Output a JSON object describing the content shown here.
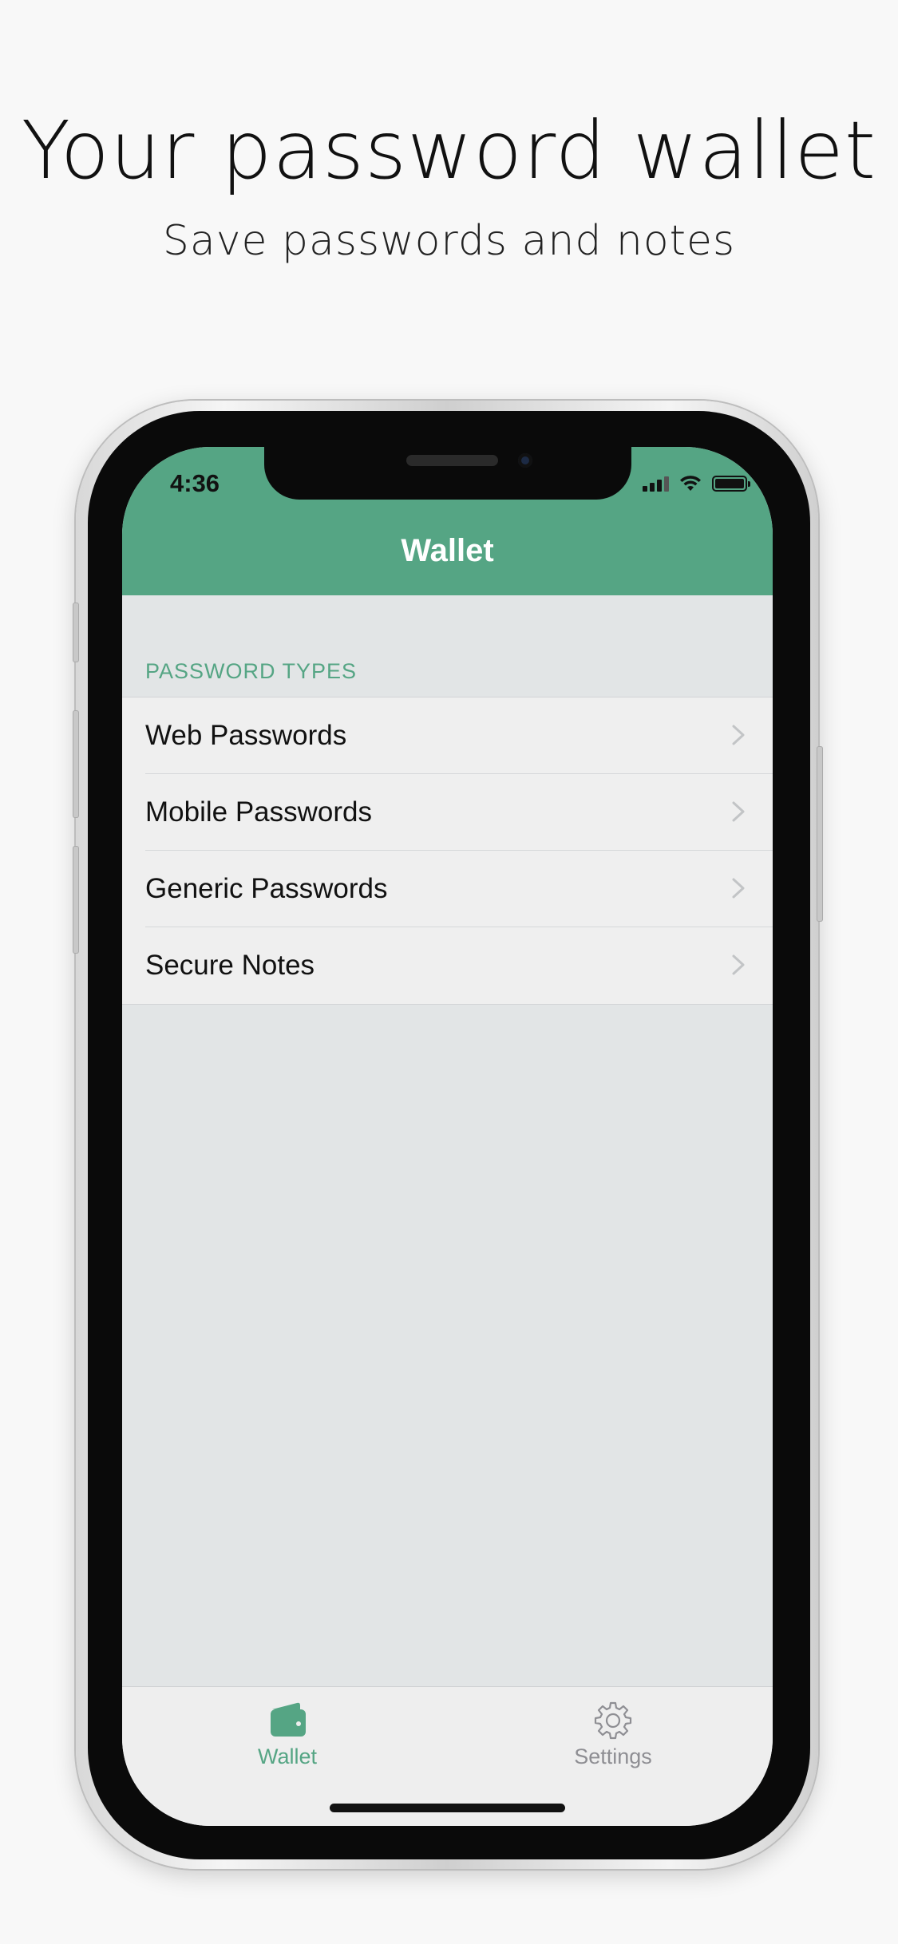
{
  "promo": {
    "headline": "Your password wallet",
    "subheadline": "Save passwords and notes"
  },
  "status_bar": {
    "time": "4:36"
  },
  "navbar": {
    "title": "Wallet"
  },
  "section": {
    "header": "PASSWORD TYPES"
  },
  "list": {
    "items": [
      {
        "label": "Web Passwords"
      },
      {
        "label": "Mobile Passwords"
      },
      {
        "label": "Generic Passwords"
      },
      {
        "label": "Secure Notes"
      }
    ]
  },
  "tabbar": {
    "tabs": [
      {
        "label": "Wallet",
        "icon": "wallet-icon",
        "selected": true
      },
      {
        "label": "Settings",
        "icon": "gear-icon",
        "selected": false
      }
    ]
  },
  "colors": {
    "accent": "#55a584",
    "background": "#e2e5e6",
    "tab_inactive": "#8e8e93"
  }
}
